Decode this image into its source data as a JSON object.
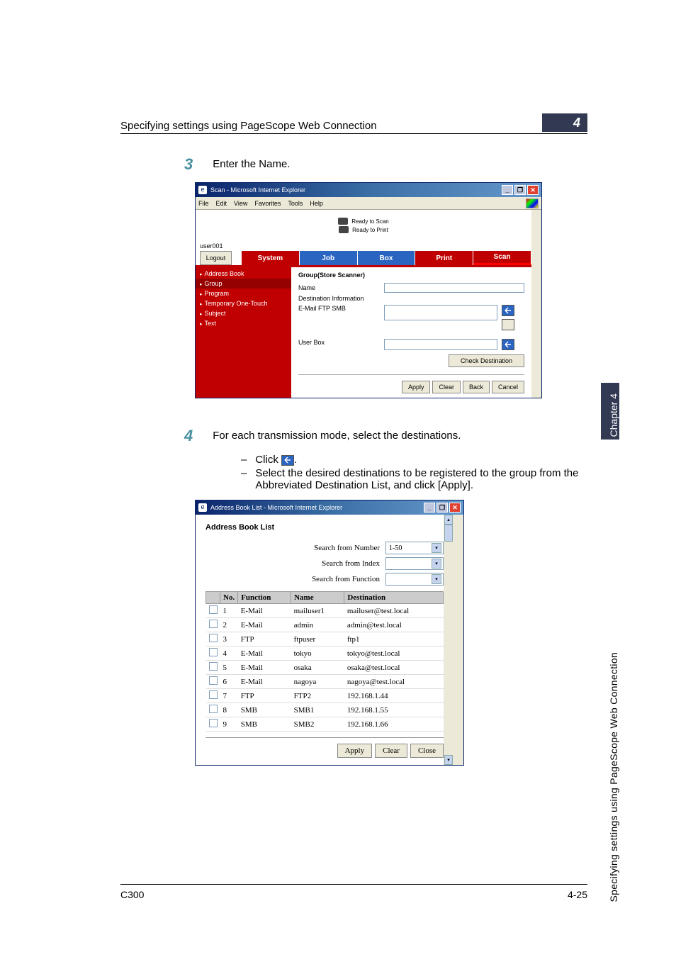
{
  "document": {
    "header_title": "Specifying settings using PageScope Web Connection",
    "page_badge": "4",
    "side_tab": "Chapter 4",
    "side_text": "Specifying settings using PageScope Web Connection",
    "footer_left": "C300",
    "footer_right": "4-25"
  },
  "step3": {
    "num": "3",
    "text": "Enter the Name."
  },
  "step4": {
    "num": "4",
    "text": "For each transmission mode, select the destinations.",
    "bullet1a": "Click ",
    "bullet1b": ".",
    "bullet2": "Select the desired destinations to be registered to the group from the Abbreviated Destination List, and click [Apply]."
  },
  "ss1": {
    "title": "Scan - Microsoft Internet Explorer",
    "menubar": [
      "File",
      "Edit",
      "View",
      "Favorites",
      "Tools",
      "Help"
    ],
    "status_scan": "Ready to Scan",
    "status_print": "Ready to Print",
    "user": "user001",
    "logout": "Logout",
    "tabs": {
      "system": "System",
      "job": "Job",
      "box": "Box",
      "print": "Print",
      "scan": "Scan"
    },
    "sidebar": [
      "Address Book",
      "Group",
      "Program",
      "Temporary One-Touch",
      "Subject",
      "Text"
    ],
    "panel": {
      "heading": "Group(Store Scanner)",
      "name_label": "Name",
      "dest_label": "Destination Information",
      "dest_info": "E-Mail FTP SMB",
      "userbox_label": "User Box",
      "check_dest": "Check Destination",
      "apply": "Apply",
      "clear": "Clear",
      "back": "Back",
      "cancel": "Cancel"
    }
  },
  "ss2": {
    "title": "Address Book List - Microsoft Internet Explorer",
    "heading": "Address Book List",
    "search_number": "Search from Number",
    "search_number_val": "1-50",
    "search_index": "Search from Index",
    "search_function": "Search from Function",
    "cols": {
      "no": "No.",
      "func": "Function",
      "name": "Name",
      "dest": "Destination"
    },
    "rows": [
      {
        "no": "1",
        "func": "E-Mail",
        "name": "mailuser1",
        "dest": "mailuser@test.local"
      },
      {
        "no": "2",
        "func": "E-Mail",
        "name": "admin",
        "dest": "admin@test.local"
      },
      {
        "no": "3",
        "func": "FTP",
        "name": "ftpuser",
        "dest": "ftp1"
      },
      {
        "no": "4",
        "func": "E-Mail",
        "name": "tokyo",
        "dest": "tokyo@test.local"
      },
      {
        "no": "5",
        "func": "E-Mail",
        "name": "osaka",
        "dest": "osaka@test.local"
      },
      {
        "no": "6",
        "func": "E-Mail",
        "name": "nagoya",
        "dest": "nagoya@test.local"
      },
      {
        "no": "7",
        "func": "FTP",
        "name": "FTP2",
        "dest": "192.168.1.44"
      },
      {
        "no": "8",
        "func": "SMB",
        "name": "SMB1",
        "dest": "192.168.1.55"
      },
      {
        "no": "9",
        "func": "SMB",
        "name": "SMB2",
        "dest": "192.168.1.66"
      }
    ],
    "apply": "Apply",
    "clear": "Clear",
    "close": "Close"
  }
}
